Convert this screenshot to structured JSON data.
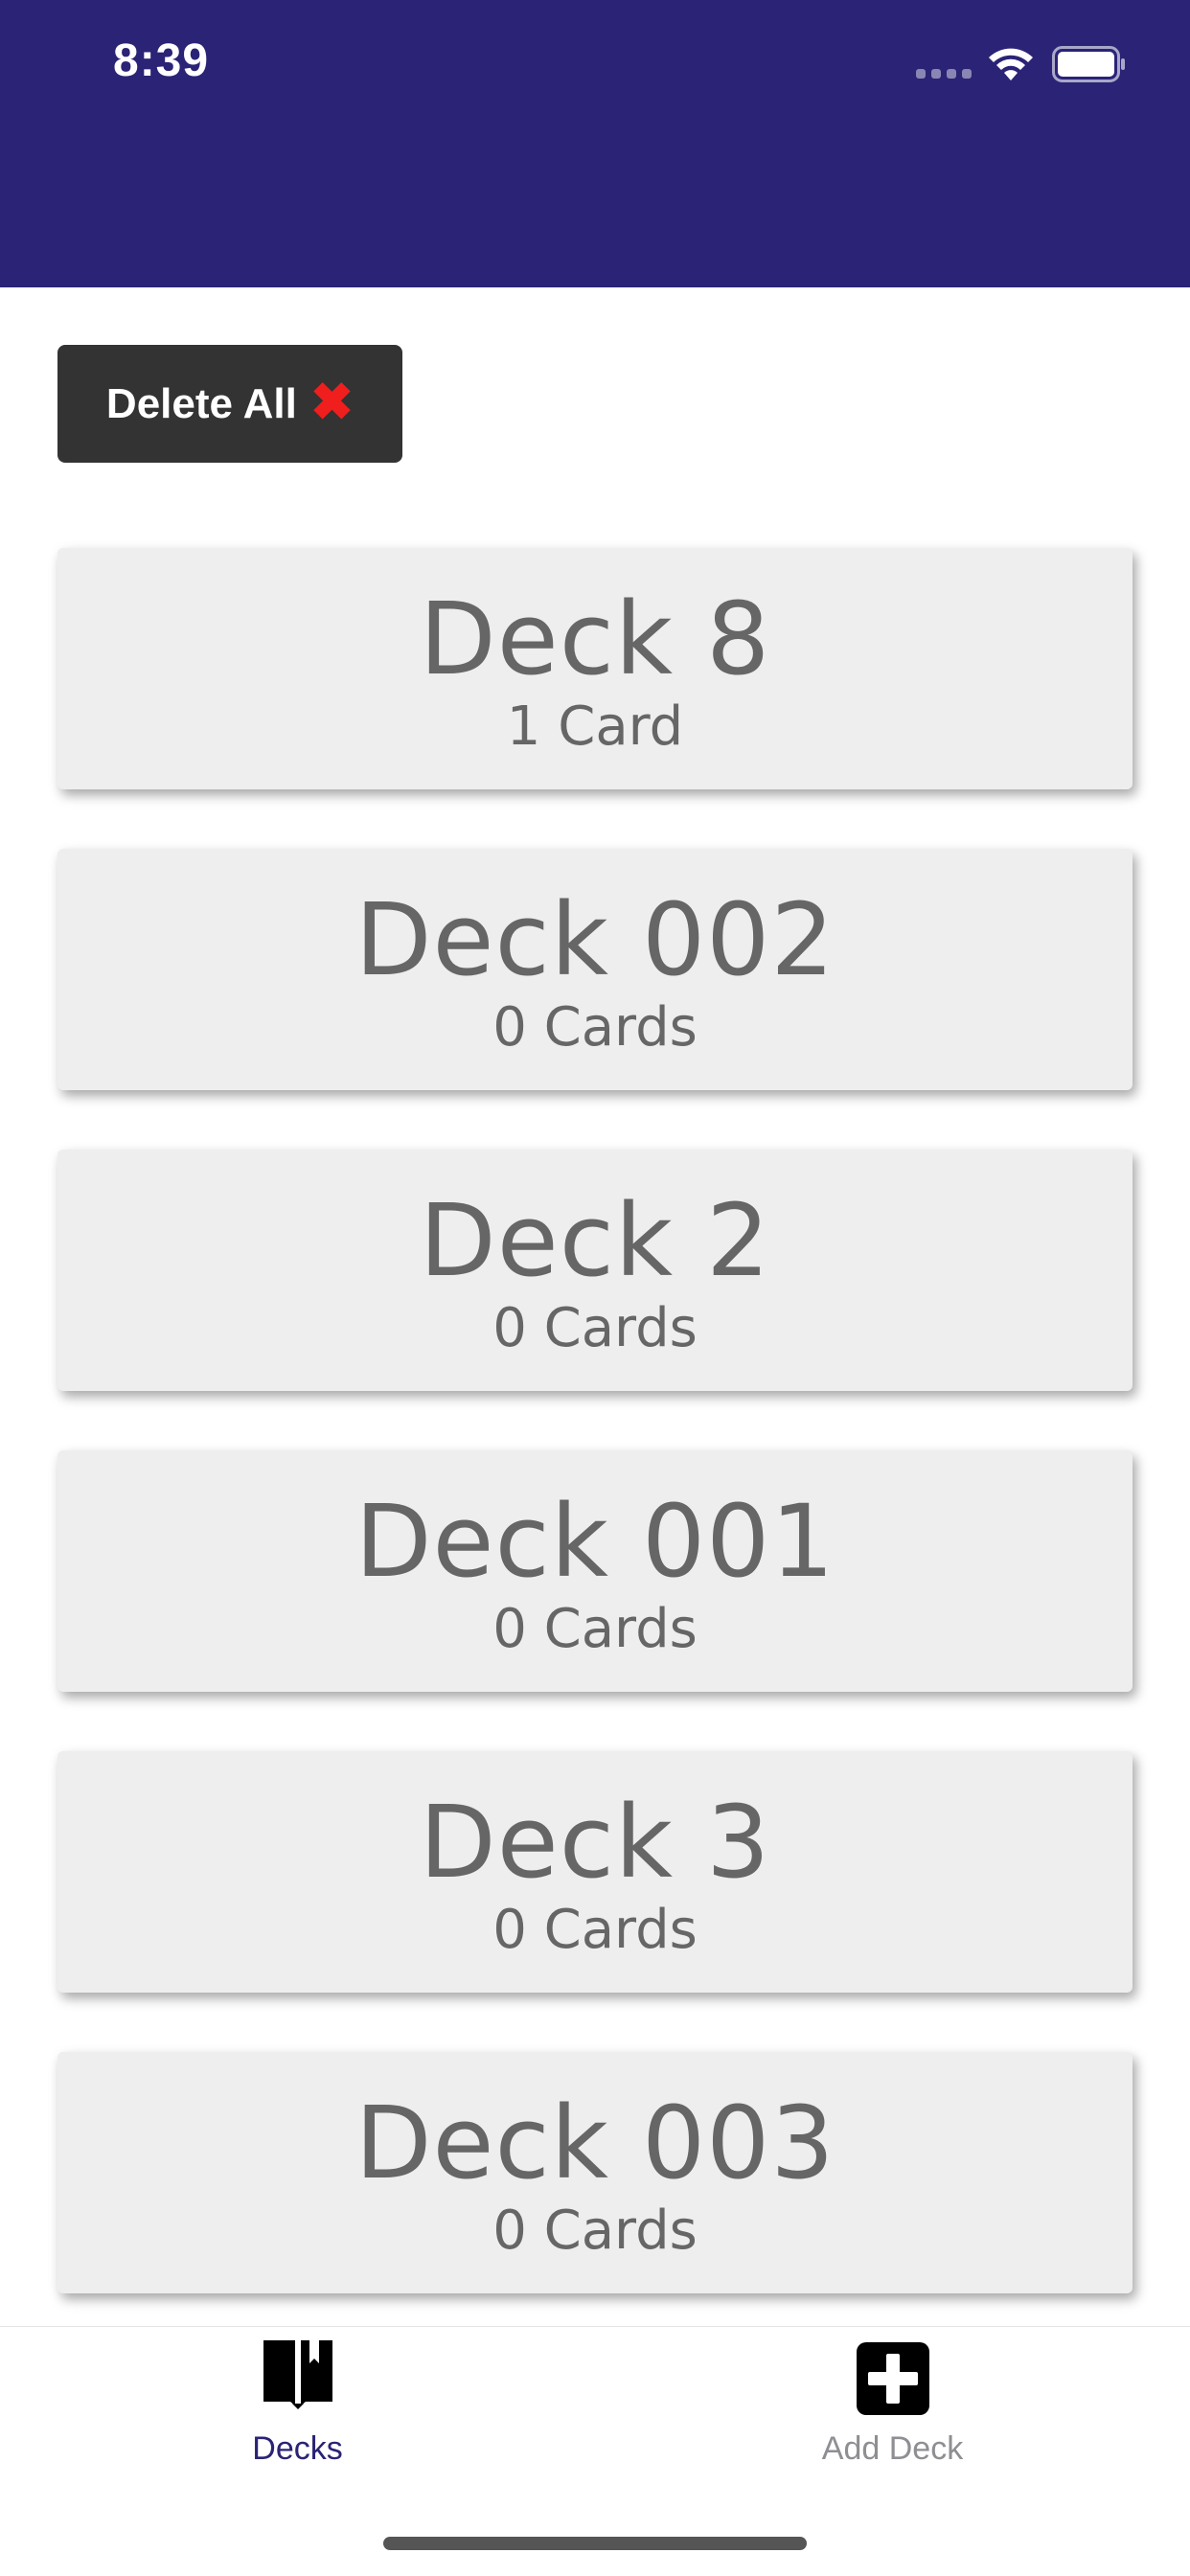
{
  "status_bar": {
    "time": "8:39"
  },
  "header": {
    "background_color": "#2a2376"
  },
  "toolbar": {
    "delete_all_label": "Delete All",
    "delete_all_icon": "✖",
    "delete_icon_color": "#f11e1e"
  },
  "decks": [
    {
      "title": "Deck 8",
      "count": "1 Card"
    },
    {
      "title": "Deck 002",
      "count": "0 Cards"
    },
    {
      "title": "Deck 2",
      "count": "0 Cards"
    },
    {
      "title": "Deck 001",
      "count": "0 Cards"
    },
    {
      "title": "Deck 3",
      "count": "0 Cards"
    },
    {
      "title": "Deck 003",
      "count": "0 Cards"
    }
  ],
  "tabbar": {
    "tabs": [
      {
        "label": "Decks",
        "icon": "book-icon",
        "active": true
      },
      {
        "label": "Add Deck",
        "icon": "plus-square-icon",
        "active": false
      }
    ]
  }
}
